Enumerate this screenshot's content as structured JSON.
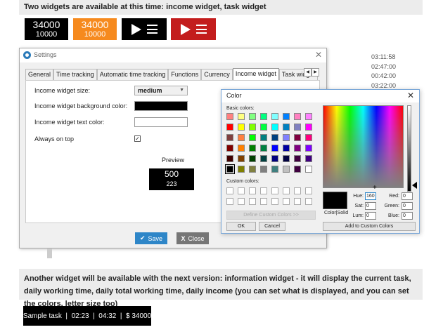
{
  "banner_top": "Two widgets are available at this time: income widget, task widget",
  "widgets": {
    "income_black": {
      "value": "34000",
      "sub": "10000"
    },
    "income_orange": {
      "value": "34000",
      "sub": "10000"
    },
    "colors": {
      "black": "#000000",
      "orange": "#f68a1e",
      "red": "#c31d1d"
    }
  },
  "times": [
    "03:11:58",
    "02:47:00",
    "00:42:00",
    "03:22:00"
  ],
  "settings": {
    "title": "Settings",
    "tabs": [
      "General",
      "Time tracking",
      "Automatic time tracking",
      "Functions",
      "Currency",
      "Income widget",
      "Task widget"
    ],
    "active_tab": "Income widget",
    "size_label": "Income widget size:",
    "size_value": "medium",
    "bg_label": "Income widget background color:",
    "bg_color": "#000000",
    "text_label": "Income widget text color:",
    "text_color": "#ffffff",
    "on_top_label": "Always on top",
    "on_top_checked": "✓",
    "preview_label": "Preview",
    "preview_value": "500",
    "preview_sub": "223",
    "save_label": "Save",
    "close_label": "Close"
  },
  "color_dialog": {
    "title": "Color",
    "basic_label": "Basic colors:",
    "custom_label": "Custom colors:",
    "basic_colors": [
      "#ff8080",
      "#ffff80",
      "#80ff80",
      "#00ff80",
      "#80ffff",
      "#0080ff",
      "#ff80c0",
      "#ff80ff",
      "#ff0000",
      "#ffff00",
      "#80ff00",
      "#00ff40",
      "#00ffff",
      "#0080c0",
      "#8080c0",
      "#ff00ff",
      "#804040",
      "#ff8040",
      "#00ff00",
      "#008080",
      "#004080",
      "#8080ff",
      "#800040",
      "#ff0080",
      "#800000",
      "#ff8000",
      "#008000",
      "#008040",
      "#0000ff",
      "#0000a0",
      "#800080",
      "#8000ff",
      "#400000",
      "#804000",
      "#004000",
      "#004040",
      "#000080",
      "#000040",
      "#400040",
      "#400080",
      "#000000",
      "#808000",
      "#808040",
      "#808080",
      "#408080",
      "#c0c0c0",
      "#400040",
      "#ffffff"
    ],
    "selected_index": 40,
    "define_label": "Define Custom Colors >>",
    "ok_label": "OK",
    "cancel_label": "Cancel",
    "color_solid_label": "Color|Solid",
    "hue_label": "Hue:",
    "hue": "160",
    "sat_label": "Sat:",
    "sat": "0",
    "lum_label": "Lum:",
    "lum": "0",
    "red_label": "Red:",
    "red": "0",
    "green_label": "Green:",
    "green": "0",
    "blue_label": "Blue:",
    "blue": "0",
    "add_label": "Add to Custom Colors"
  },
  "banner_bottom": "Another widget will be available with the next version: information widget - it will display the current task, daily working time, daily total working time, daily income (you can set what is displayed, and you can set the colors, letter size too)",
  "sample_widget": "Sample task  |  02:23  |  04:32  |  $ 34000"
}
